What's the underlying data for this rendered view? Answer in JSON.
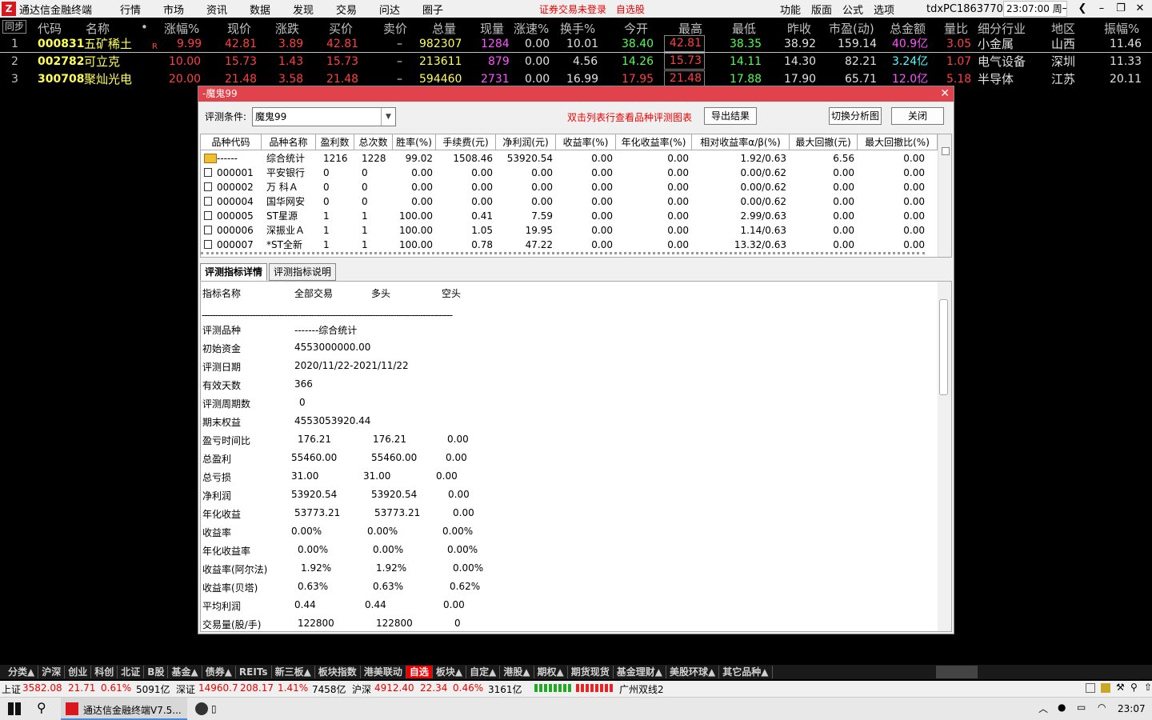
{
  "app": {
    "title": "通达信金融终端",
    "menu": [
      "行情",
      "市场",
      "资讯",
      "数据",
      "发现",
      "交易",
      "问达",
      "圈子"
    ],
    "warn1": "证券交易未登录",
    "warn2": "自选股",
    "rmenu": [
      "功能",
      "版面",
      "公式",
      "选项"
    ],
    "pc": "tdxPC1863770",
    "clock": "23:07:00 周一"
  },
  "quote": {
    "sync": "同步",
    "headers": [
      "代码",
      "名称",
      "•",
      "涨幅%",
      "现价",
      "涨跌",
      "买价",
      "卖价",
      "总量",
      "现量",
      "涨速%",
      "换手%",
      "今开",
      "最高",
      "最低",
      "昨收",
      "市盈(动)",
      "总金额",
      "量比",
      "细分行业",
      "地区",
      "振幅%"
    ],
    "rows": [
      {
        "idx": "1",
        "code": "000831",
        "name": "五矿稀土",
        "flag": "R",
        "chg_pct": "9.99",
        "price": "42.81",
        "chg": "3.89",
        "bid": "42.81",
        "ask": "–",
        "vol": "982307",
        "cur_vol": "1284",
        "speed": "0.00",
        "turnover": "10.01",
        "open": "38.40",
        "high": "42.81",
        "low": "38.35",
        "prev": "38.92",
        "pe": "159.14",
        "amount": "40.9亿",
        "vol_ratio": "3.05",
        "industry": "小金属",
        "region": "山西",
        "amp": "11.46"
      },
      {
        "idx": "2",
        "code": "002782",
        "name": "可立克",
        "flag": "",
        "chg_pct": "10.00",
        "price": "15.73",
        "chg": "1.43",
        "bid": "15.73",
        "ask": "–",
        "vol": "213611",
        "cur_vol": "879",
        "speed": "0.00",
        "turnover": "4.56",
        "open": "14.26",
        "high": "15.73",
        "low": "14.11",
        "prev": "14.30",
        "pe": "82.21",
        "amount": "3.24亿",
        "vol_ratio": "1.07",
        "industry": "电气设备",
        "region": "深圳",
        "amp": "11.33"
      },
      {
        "idx": "3",
        "code": "300708",
        "name": "聚灿光电",
        "flag": "",
        "chg_pct": "20.00",
        "price": "21.48",
        "chg": "3.58",
        "bid": "21.48",
        "ask": "–",
        "vol": "594460",
        "cur_vol": "2731",
        "speed": "0.00",
        "turnover": "16.99",
        "open": "17.95",
        "high": "21.48",
        "low": "17.88",
        "prev": "17.90",
        "pe": "65.71",
        "amount": "12.0亿",
        "vol_ratio": "5.18",
        "industry": "半导体",
        "region": "江苏",
        "amp": "20.11"
      }
    ]
  },
  "dialog": {
    "title": "-魔鬼99",
    "cond_label": "评测条件:",
    "cond_value": "魔鬼99",
    "hint": "双击列表行查看品种评测图表",
    "btn_export": "导出结果",
    "btn_switch": "切换分析图",
    "btn_close": "关闭",
    "grid_headers": [
      "品种代码",
      "品种名称",
      "盈利数",
      "总次数",
      "胜率(%)",
      "手续费(元)",
      "净利润(元)",
      "收益率(%)",
      "年化收益率(%)",
      "相对收益率α/β(%)",
      "最大回撤(元)",
      "最大回撤比(%)"
    ],
    "grid_rows": [
      [
        "------",
        "综合统计",
        "1216",
        "1228",
        "99.02",
        "1508.46",
        "53920.54",
        "0.00",
        "0.00",
        "1.92/0.63",
        "6.56",
        "0.00"
      ],
      [
        "000001",
        "平安银行",
        "0",
        "0",
        "0.00",
        "0.00",
        "0.00",
        "0.00",
        "0.00",
        "0.00/0.62",
        "0.00",
        "0.00"
      ],
      [
        "000002",
        "万 科Ａ",
        "0",
        "0",
        "0.00",
        "0.00",
        "0.00",
        "0.00",
        "0.00",
        "0.00/0.62",
        "0.00",
        "0.00"
      ],
      [
        "000004",
        "国华网安",
        "0",
        "0",
        "0.00",
        "0.00",
        "0.00",
        "0.00",
        "0.00",
        "0.00/0.62",
        "0.00",
        "0.00"
      ],
      [
        "000005",
        "ST星源",
        "1",
        "1",
        "100.00",
        "0.41",
        "7.59",
        "0.00",
        "0.00",
        "2.99/0.63",
        "0.00",
        "0.00"
      ],
      [
        "000006",
        "深振业Ａ",
        "1",
        "1",
        "100.00",
        "1.05",
        "19.95",
        "0.00",
        "0.00",
        "1.14/0.63",
        "0.00",
        "0.00"
      ],
      [
        "000007",
        "*ST全新",
        "1",
        "1",
        "100.00",
        "0.78",
        "47.22",
        "0.00",
        "0.00",
        "13.32/0.63",
        "0.00",
        "0.00"
      ]
    ],
    "tabs": [
      "评测指标详情",
      "评测指标说明"
    ],
    "detail_header": [
      "指标名称",
      "全部交易",
      "多头",
      "空头"
    ],
    "separator": "----------------------------------------------------------------------------------------------",
    "detail_rows": [
      [
        "评测品种",
        "-------综合统计",
        "",
        ""
      ],
      [
        "初始资金",
        "4553000000.00",
        "",
        ""
      ],
      [
        "评测日期",
        "2020/11/22-2021/11/22",
        "",
        ""
      ],
      [
        "有效天数",
        "366",
        "",
        ""
      ],
      [
        "评测周期数",
        "0",
        "",
        ""
      ],
      [
        "期末权益",
        "4553053920.44",
        "",
        ""
      ],
      [
        "盈亏时间比",
        "176.21",
        "176.21",
        "0.00"
      ],
      [
        "总盈利",
        "55460.00",
        "55460.00",
        "0.00"
      ],
      [
        "总亏损",
        "31.00",
        "31.00",
        "0.00"
      ],
      [
        "净利润",
        "53920.54",
        "53920.54",
        "0.00"
      ],
      [
        "年化收益",
        "53773.21",
        "53773.21",
        "0.00"
      ],
      [
        "收益率",
        "0.00%",
        "0.00%",
        "0.00%"
      ],
      [
        "年化收益率",
        "0.00%",
        "0.00%",
        "0.00%"
      ],
      [
        "收益率(阿尔法)",
        "1.92%",
        "1.92%",
        "0.00%"
      ],
      [
        "收益率(贝塔)",
        "0.63%",
        "0.63%",
        "0.62%"
      ],
      [
        "平均利润",
        "0.44",
        "0.44",
        "0.00"
      ],
      [
        "交易量(股/手)",
        "122800",
        "122800",
        "0"
      ]
    ]
  },
  "bottom_tabs": [
    "分类▲",
    "沪深",
    "创业",
    "科创",
    "北证",
    "B股",
    "基金▲",
    "债券▲",
    "REITs",
    "新三板▲",
    "板块指数",
    "港美联动",
    "自选",
    "板块▲",
    "自定▲",
    "港股▲",
    "期权▲",
    "期货现货",
    "基金理财▲",
    "美股环球▲",
    "其它品种▲"
  ],
  "index_bar": {
    "sh_label": "上证",
    "sh_val": "3582.08",
    "sh_chg": "21.71",
    "sh_pct": "0.61%",
    "sh_amt": "5091亿",
    "sz_label": "深证",
    "sz_val": "14960.7",
    "sz_chg": "208.17",
    "sz_pct": "1.41%",
    "sz_amt": "7458亿",
    "hs_label": "沪深",
    "hs_val": "4912.40",
    "hs_chg": "22.34",
    "hs_pct": "0.46%",
    "hs_amt": "3161亿",
    "server": "广州双线2"
  },
  "taskbar": {
    "app1": "通达信金融终端V7.5...",
    "app2": "▯",
    "time": "23:07"
  }
}
